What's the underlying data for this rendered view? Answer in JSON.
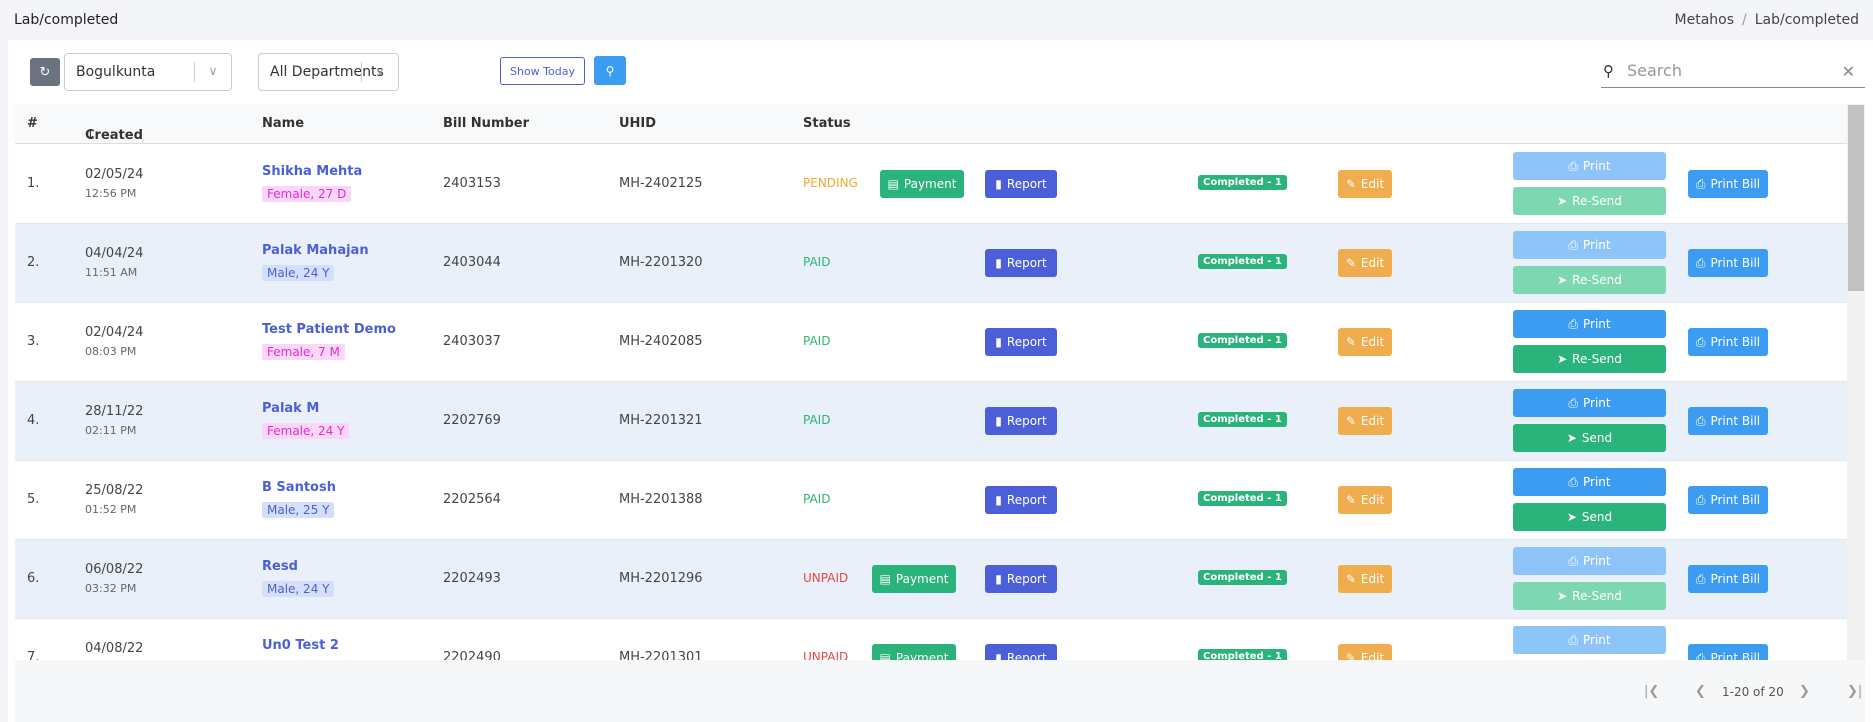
{
  "page": {
    "title": "Lab/completed",
    "breadcrumb": [
      "Metahos",
      "Lab/completed"
    ]
  },
  "toolbar": {
    "refresh_icon": "refresh-icon",
    "branch": "Bogulkunta",
    "department": "All Departments",
    "show_today": "Show Today",
    "search_placeholder": "Search"
  },
  "columns": {
    "idx": "#",
    "created": "Created",
    "name": "Name",
    "bill": "Bill Number",
    "uhid": "UHID",
    "status": "Status"
  },
  "labels": {
    "payment": "Payment",
    "report": "Report",
    "edit": "Edit",
    "print": "Print",
    "resend": "Re-Send",
    "send": "Send",
    "print_bill": "Print Bill"
  },
  "rows": [
    {
      "idx": "1.",
      "date": "02/05/24",
      "time": "12:56 PM",
      "name": "Shikha Mehta",
      "info": "Female, 27 D",
      "gender": "female",
      "bill": "2403153",
      "uhid": "MH-2402125",
      "status": "PENDING",
      "badge": "Completed - 1",
      "payment": true,
      "print_enabled": false,
      "send_label": "Re-Send"
    },
    {
      "idx": "2.",
      "date": "04/04/24",
      "time": "11:51 AM",
      "name": "Palak Mahajan",
      "info": "Male, 24 Y",
      "gender": "male",
      "bill": "2403044",
      "uhid": "MH-2201320",
      "status": "PAID",
      "badge": "Completed - 1",
      "payment": false,
      "print_enabled": false,
      "send_label": "Re-Send"
    },
    {
      "idx": "3.",
      "date": "02/04/24",
      "time": "08:03 PM",
      "name": "Test Patient Demo",
      "info": "Female, 7 M",
      "gender": "female",
      "bill": "2403037",
      "uhid": "MH-2402085",
      "status": "PAID",
      "badge": "Completed - 1",
      "payment": false,
      "print_enabled": true,
      "send_label": "Re-Send"
    },
    {
      "idx": "4.",
      "date": "28/11/22",
      "time": "02:11 PM",
      "name": "Palak M",
      "info": "Female, 24 Y",
      "gender": "female",
      "bill": "2202769",
      "uhid": "MH-2201321",
      "status": "PAID",
      "badge": "Completed - 1",
      "payment": false,
      "print_enabled": true,
      "send_label": "Send"
    },
    {
      "idx": "5.",
      "date": "25/08/22",
      "time": "01:52 PM",
      "name": "B Santosh",
      "info": "Male, 25 Y",
      "gender": "male",
      "bill": "2202564",
      "uhid": "MH-2201388",
      "status": "PAID",
      "badge": "Completed - 1",
      "payment": false,
      "print_enabled": true,
      "send_label": "Send"
    },
    {
      "idx": "6.",
      "date": "06/08/22",
      "time": "03:32 PM",
      "name": "Resd",
      "info": "Male, 24 Y",
      "gender": "male",
      "bill": "2202493",
      "uhid": "MH-2201296",
      "status": "UNPAID",
      "badge": "Completed - 1",
      "payment": true,
      "print_enabled": false,
      "send_label": "Re-Send"
    },
    {
      "idx": "7.",
      "date": "04/08/22",
      "time": "",
      "name": "Un0 Test 2",
      "info": "",
      "gender": "male",
      "bill": "2202490",
      "uhid": "MH-2201301",
      "status": "UNPAID",
      "badge": "Completed - 1",
      "payment": true,
      "print_enabled": false,
      "send_label": ""
    }
  ],
  "pagination": {
    "range": "1-20 of 20"
  }
}
